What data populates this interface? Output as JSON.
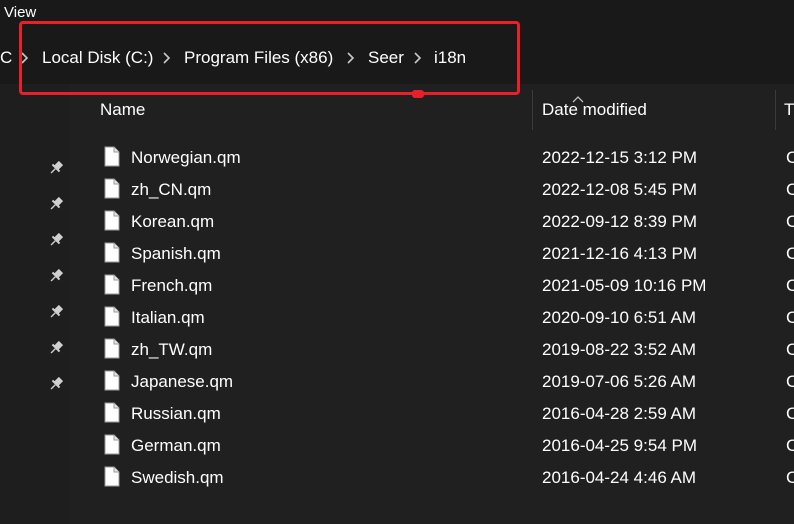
{
  "menubar": {
    "view_label": "View"
  },
  "breadcrumb": {
    "items": [
      "C",
      "Local Disk (C:)",
      "Program Files (x86)",
      "Seer",
      "i18n"
    ]
  },
  "columns": {
    "name": "Name",
    "date_modified": "Date modified",
    "type": "T"
  },
  "files": [
    {
      "name": "Norwegian.qm",
      "date": "2022-12-15 3:12 PM",
      "type": "C"
    },
    {
      "name": "zh_CN.qm",
      "date": "2022-12-08 5:45 PM",
      "type": "C"
    },
    {
      "name": "Korean.qm",
      "date": "2022-09-12 8:39 PM",
      "type": "C"
    },
    {
      "name": "Spanish.qm",
      "date": "2021-12-16 4:13 PM",
      "type": "C"
    },
    {
      "name": "French.qm",
      "date": "2021-05-09 10:16 PM",
      "type": "C"
    },
    {
      "name": "Italian.qm",
      "date": "2020-09-10 6:51 AM",
      "type": "C"
    },
    {
      "name": "zh_TW.qm",
      "date": "2019-08-22 3:52 AM",
      "type": "C"
    },
    {
      "name": "Japanese.qm",
      "date": "2019-07-06 5:26 AM",
      "type": "C"
    },
    {
      "name": "Russian.qm",
      "date": "2016-04-28 2:59 AM",
      "type": "C"
    },
    {
      "name": "German.qm",
      "date": "2016-04-25 9:54 PM",
      "type": "C"
    },
    {
      "name": "Swedish.qm",
      "date": "2016-04-24 4:46 AM",
      "type": "C"
    }
  ],
  "quick_access_pins": [
    "pin",
    "pin",
    "pin",
    "pin",
    "pin",
    "pin",
    "pin"
  ],
  "colors": {
    "background": "#191919",
    "content": "#202020",
    "highlight": "#e8202a"
  }
}
